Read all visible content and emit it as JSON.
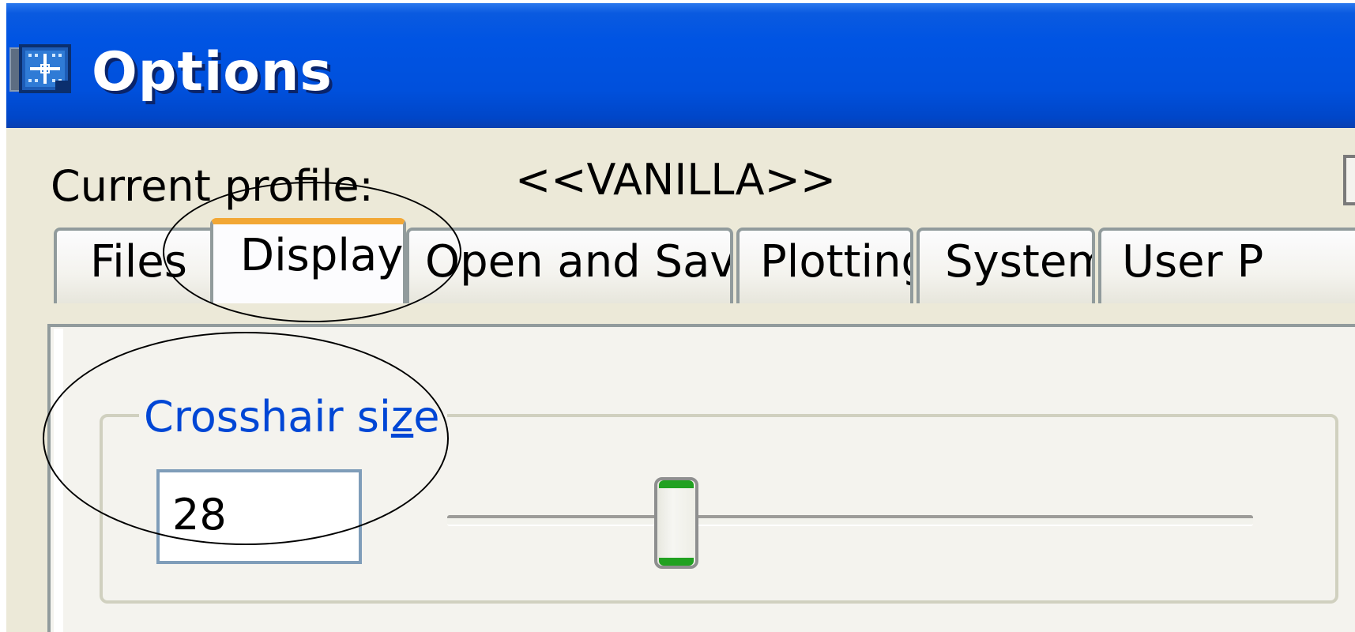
{
  "window": {
    "title": "Options",
    "title_icon": "options-app-icon"
  },
  "profile": {
    "label": "Current profile:",
    "value": "<<VANILLA>>"
  },
  "tabs": [
    {
      "label": "Files",
      "active": false
    },
    {
      "label": "Display",
      "active": true
    },
    {
      "label": "Open and Save",
      "active": false
    },
    {
      "label": "Plotting",
      "active": false
    },
    {
      "label": "System",
      "active": false
    },
    {
      "label": "User P",
      "active": false
    }
  ],
  "crosshair": {
    "group_label_pre": "Crosshair si",
    "group_label_ul": "z",
    "group_label_post": "e",
    "value": "28",
    "slider_level_percent": 28
  },
  "colors": {
    "titlebar": "#0054e3",
    "active_tab_accent": "#f2a735",
    "group_label": "#0046d5",
    "slider_thumb_accent": "#21a121",
    "dialog_background": "#ece9d8"
  },
  "annotations": [
    "circle-highlight-display-tab",
    "circle-highlight-crosshair-size"
  ]
}
